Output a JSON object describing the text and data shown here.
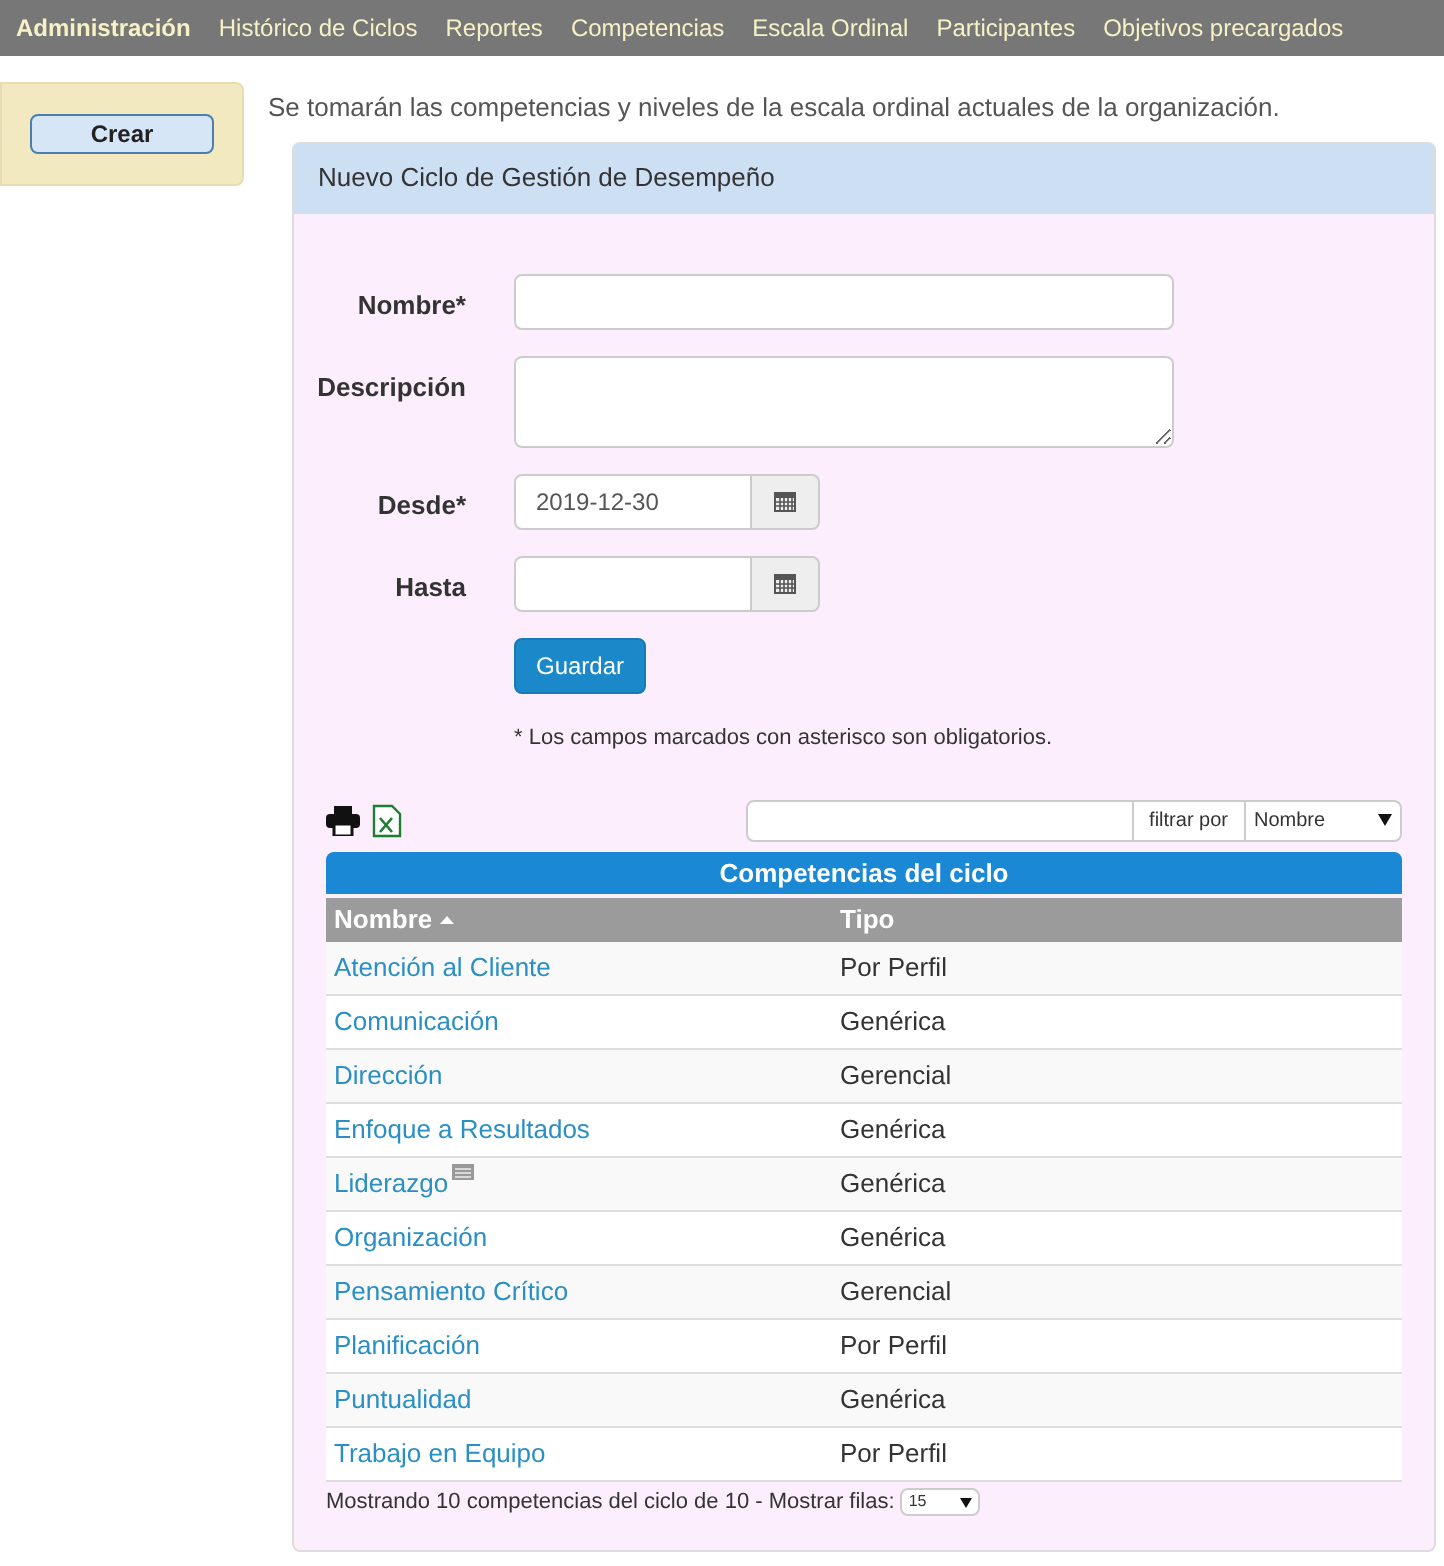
{
  "nav": [
    {
      "label": "Administración",
      "selected": true
    },
    {
      "label": "Histórico de Ciclos",
      "selected": false
    },
    {
      "label": "Reportes",
      "selected": false
    },
    {
      "label": "Competencias",
      "selected": false
    },
    {
      "label": "Escala Ordinal",
      "selected": false
    },
    {
      "label": "Participantes",
      "selected": false
    },
    {
      "label": "Objetivos precargados",
      "selected": false
    }
  ],
  "sidebar": {
    "button": "Crear"
  },
  "notice": "Se tomarán las competencias y niveles de la escala ordinal actuales de la organización.",
  "panel": {
    "title": "Nuevo Ciclo de Gestión de Desempeño",
    "form": [
      {
        "label": "Nombre*",
        "kind": "text"
      },
      {
        "label": "Descripción",
        "kind": "textarea"
      },
      {
        "label": "Desde*",
        "kind": "date",
        "value": "2019-12-30"
      },
      {
        "label": "Hasta",
        "kind": "date"
      }
    ],
    "save_button": "Guardar",
    "footnote": "* Los campos marcados con asterisco son obligatorios.",
    "filter": {
      "button": "filtrar por",
      "select": "Nombre"
    },
    "table": {
      "title": "Competencias del ciclo",
      "columns": [
        {
          "label": "Nombre",
          "sorted": true
        },
        {
          "label": "Tipo",
          "sorted": false
        }
      ],
      "rows": [
        {
          "name": "Atención al Cliente",
          "type": "Por Perfil",
          "has_note": false
        },
        {
          "name": "Comunicación",
          "type": "Genérica",
          "has_note": false
        },
        {
          "name": "Dirección",
          "type": "Gerencial",
          "has_note": false
        },
        {
          "name": "Enfoque a Resultados",
          "type": "Genérica",
          "has_note": false
        },
        {
          "name": "Liderazgo",
          "type": "Genérica",
          "has_note": true
        },
        {
          "name": "Organización",
          "type": "Genérica",
          "has_note": false
        },
        {
          "name": "Pensamiento Crítico",
          "type": "Gerencial",
          "has_note": false
        },
        {
          "name": "Planificación",
          "type": "Por Perfil",
          "has_note": false
        },
        {
          "name": "Puntualidad",
          "type": "Genérica",
          "has_note": false
        },
        {
          "name": "Trabajo en Equipo",
          "type": "Por Perfil",
          "has_note": false
        }
      ],
      "footer": "Mostrando 10 competencias del ciclo de 10 - Mostrar filas:",
      "rows_select": "15"
    }
  }
}
